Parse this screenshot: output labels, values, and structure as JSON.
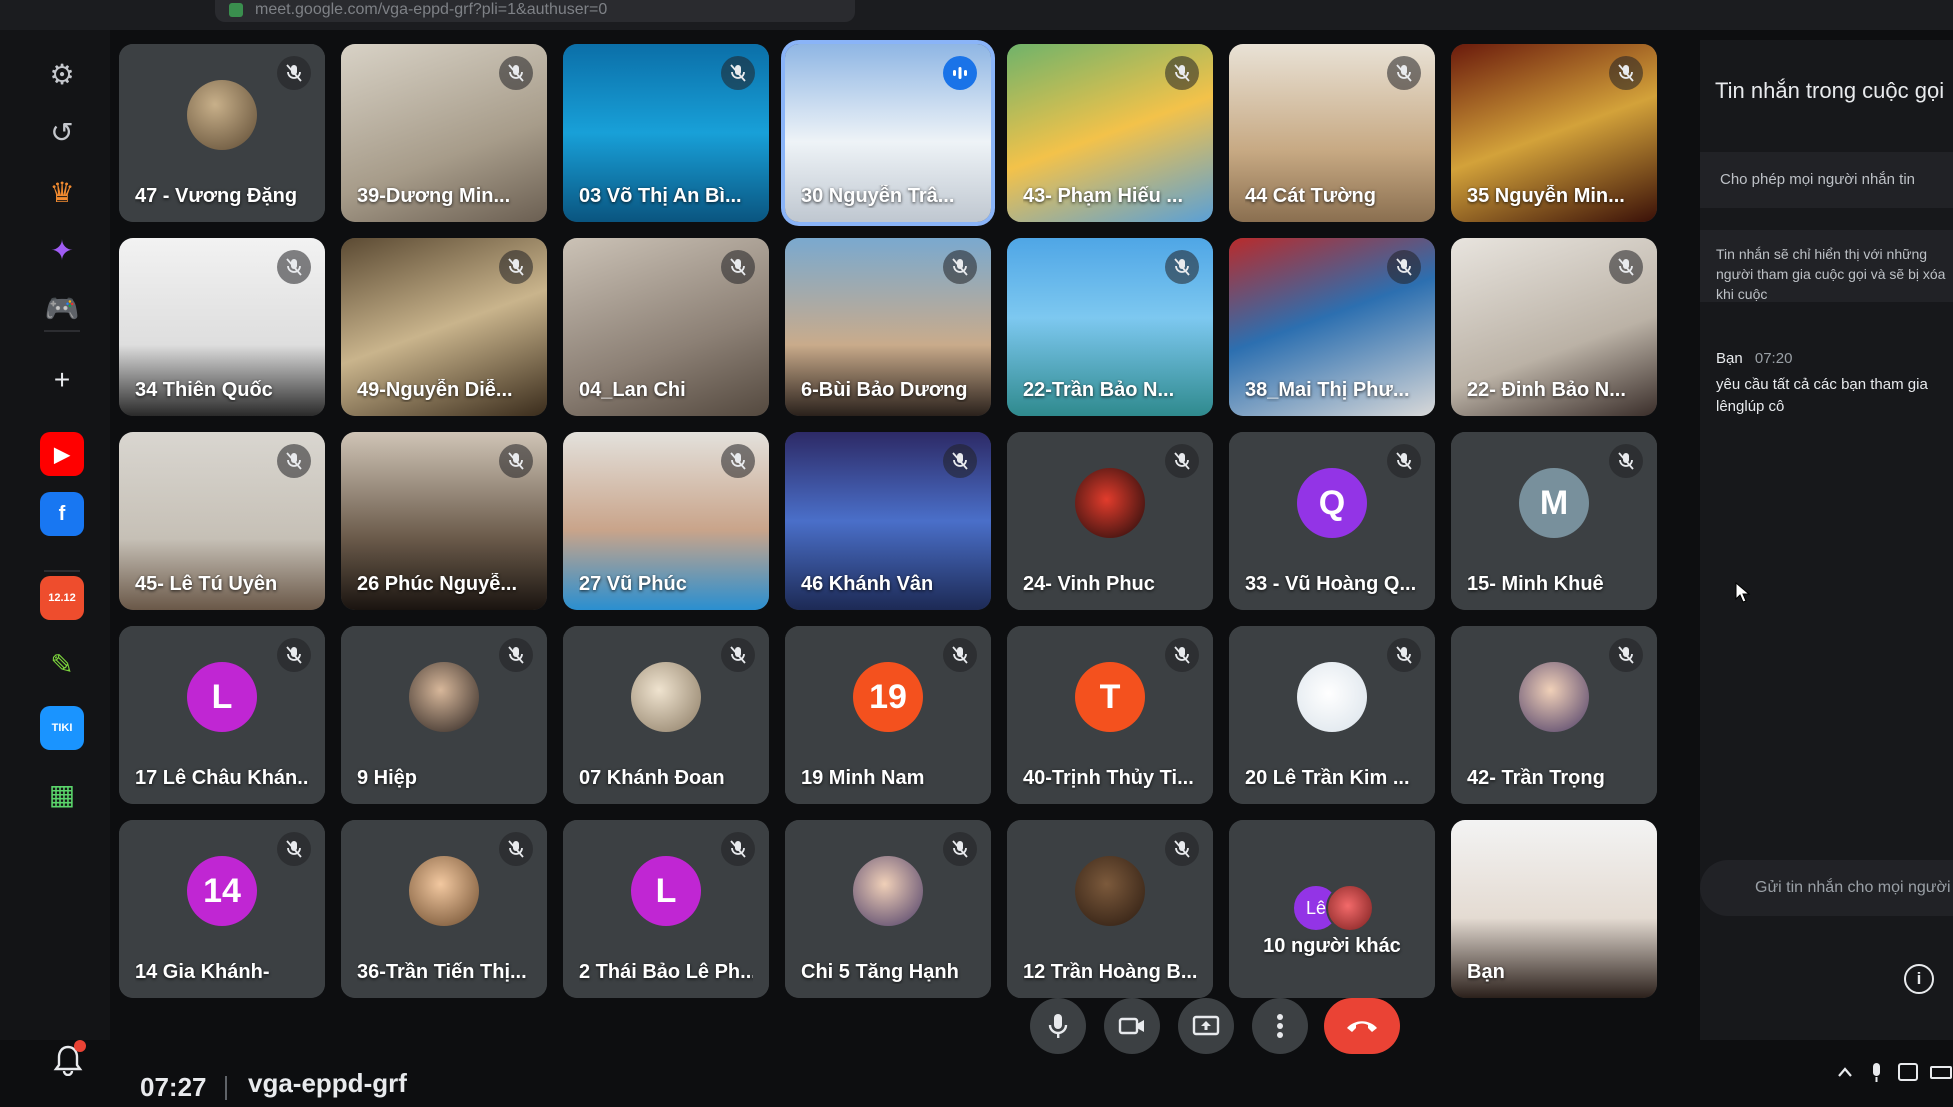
{
  "browser": {
    "url": "meet.google.com/vga-eppd-grf?pli=1&authuser=0"
  },
  "sidebar": {
    "items": [
      {
        "name": "settings-icon",
        "glyph": "⚙",
        "color": "#c4c7cc"
      },
      {
        "name": "history-icon",
        "glyph": "↺",
        "color": "#c4c7cc"
      },
      {
        "name": "crown-icon",
        "glyph": "♛",
        "color": "#f28b30"
      },
      {
        "name": "messenger-icon",
        "glyph": "✦",
        "color": "#a05cf5"
      },
      {
        "name": "gamepad-icon",
        "glyph": "🎮",
        "color": "#34c759"
      },
      {
        "name": "add-icon",
        "glyph": "+",
        "color": "#e8eaed"
      },
      {
        "name": "youtube-icon",
        "glyph": "▶",
        "color": "#ff0000"
      },
      {
        "name": "facebook-icon",
        "glyph": "f",
        "color": "#1877f2"
      },
      {
        "name": "calendar-icon",
        "glyph": "12.12",
        "color": "#ee4d2d"
      },
      {
        "name": "paint-icon",
        "glyph": "✎",
        "color": "#7bd23c"
      },
      {
        "name": "tiki-icon",
        "glyph": "TIKI",
        "color": "#1a94ff"
      },
      {
        "name": "grid-icon",
        "glyph": "▦",
        "color": "#5bd66b"
      }
    ]
  },
  "participants": [
    {
      "name": "47 - Vương Đặng",
      "kind": "avatar",
      "style": "photo-avatar",
      "bg": "#3c4043"
    },
    {
      "name": "39-Dương Min...",
      "kind": "video",
      "bg": "linear-gradient(160deg,#d8d2c6,#a79c8a 60%,#6b5f52)"
    },
    {
      "name": "03 Võ Thị An Bì...",
      "kind": "video",
      "bg": "linear-gradient(180deg,#0b6fa8,#18a0d8 50%,#0a5580)"
    },
    {
      "name": "30 Nguyễn Trâ...",
      "kind": "video",
      "bg": "linear-gradient(180deg,#8fb6e4,#eef3f7 55%,#bfc7d0)",
      "active": true
    },
    {
      "name": "43- Phạm Hiếu ...",
      "kind": "video",
      "bg": "linear-gradient(160deg,#6fb36a,#f3c24a 50%,#5aa0d6)"
    },
    {
      "name": "44 Cát Tường",
      "kind": "video",
      "bg": "linear-gradient(180deg,#e9e2d6,#c7a983 60%,#8a6f50)"
    },
    {
      "name": "35 Nguyễn Min...",
      "kind": "video",
      "bg": "linear-gradient(160deg,#6a1a0c,#d3a23a 50%,#3a1008)"
    },
    {
      "name": "34 Thiên Quốc",
      "kind": "video",
      "bg": "linear-gradient(180deg,#f2f2f2,#dedede 60%,#2a2a2a)"
    },
    {
      "name": "49-Nguyễn Diễ...",
      "kind": "video",
      "bg": "linear-gradient(160deg,#5b4a33,#c9b48c 50%,#3a2c1c)"
    },
    {
      "name": "04_Lan Chi",
      "kind": "video",
      "bg": "linear-gradient(160deg,#cbc2b6,#8c8075 60%,#54493f)"
    },
    {
      "name": "6-Bùi Bảo Dương",
      "kind": "video",
      "bg": "linear-gradient(180deg,#7aa9cf,#c9ab8b 60%,#2a211c)"
    },
    {
      "name": "22-Trần Bảo N...",
      "kind": "video",
      "bg": "linear-gradient(180deg,#4fa6e6,#7dc8f0 45%,#2f8a8e)"
    },
    {
      "name": "38_Mai Thị Phư...",
      "kind": "video",
      "bg": "linear-gradient(160deg,#b92b2b,#2c6fb0 45%,#d8d8d8)"
    },
    {
      "name": "22- Đinh Bảo N...",
      "kind": "video",
      "bg": "linear-gradient(160deg,#e8e4de,#bbb2a6 60%,#3a2e2a)"
    },
    {
      "name": "45- Lê Tú Uyên",
      "kind": "video",
      "bg": "linear-gradient(180deg,#d9d6d0,#c6c0b6 60%,#6a5848)"
    },
    {
      "name": "26 Phúc Nguyễ...",
      "kind": "video",
      "bg": "linear-gradient(180deg,#cfc4b6,#6a5a4a 60%,#1a1410)"
    },
    {
      "name": "27 Vũ Phúc",
      "kind": "video",
      "bg": "linear-gradient(180deg,#e3e1dc,#c9a48a 55%,#2a8fd0)"
    },
    {
      "name": "46 Khánh Vân",
      "kind": "video",
      "bg": "linear-gradient(180deg,#2d2a66,#4a6fc9 50%,#1d2a55)"
    },
    {
      "name": "24- Vinh Phuc",
      "kind": "avatar",
      "style": "photo-avatar red",
      "bg": "#3c4043"
    },
    {
      "name": "33 - Vũ Hoàng Q...",
      "kind": "letter",
      "letter": "Q",
      "color": "#9334e6",
      "bg": "#3c4043"
    },
    {
      "name": "15- Minh Khuê",
      "kind": "letter",
      "letter": "M",
      "color": "#78909c",
      "bg": "#3c4043"
    },
    {
      "name": "17 Lê Châu Khán...",
      "kind": "letter",
      "letter": "L",
      "color": "#c026d3",
      "bg": "#3c4043"
    },
    {
      "name": "9 Hiệp",
      "kind": "avatar",
      "style": "photo-avatar girl",
      "bg": "#3c4043"
    },
    {
      "name": "07 Khánh Đoan",
      "kind": "avatar",
      "style": "photo-avatar cat",
      "bg": "#3c4043"
    },
    {
      "name": "19 Minh Nam",
      "kind": "letter",
      "letter": "19",
      "color": "#f4511e",
      "bg": "#3c4043"
    },
    {
      "name": "40-Trịnh Thủy Ti...",
      "kind": "letter",
      "letter": "T",
      "color": "#f4511e",
      "bg": "#3c4043"
    },
    {
      "name": "20 Lê Trần Kim ...",
      "kind": "avatar",
      "style": "photo-avatar white",
      "bg": "#3c4043"
    },
    {
      "name": "42- Trần Trọng",
      "kind": "avatar",
      "style": "photo-avatar face",
      "bg": "#3c4043"
    },
    {
      "name": "14 Gia Khánh-",
      "kind": "letter",
      "letter": "14",
      "color": "#c026d3",
      "bg": "#3c4043"
    },
    {
      "name": "36-Trần Tiến Thị...",
      "kind": "avatar",
      "style": "photo-avatar kid",
      "bg": "#3c4043"
    },
    {
      "name": "2 Thái Bảo Lê Ph...",
      "kind": "letter",
      "letter": "L",
      "color": "#c026d3",
      "bg": "#3c4043"
    },
    {
      "name": "Chi 5 Tăng Hạnh",
      "kind": "avatar",
      "style": "photo-avatar face",
      "bg": "#3c4043"
    },
    {
      "name": "12 Trần Hoàng B...",
      "kind": "avatar",
      "style": "photo-avatar dark",
      "bg": "#3c4043"
    },
    {
      "name": "10 người khác",
      "kind": "stack",
      "stack_letter": "Lê",
      "bg": "#3c4043",
      "nomute": true
    },
    {
      "name": "Bạn",
      "kind": "video",
      "bg": "linear-gradient(180deg,#f3f3f3,#e4dbd2 55%,#2b201b)",
      "nomute": true
    }
  ],
  "chat": {
    "title": "Tin nhắn trong cuộc gọi",
    "allow_label": "Cho phép mọi người nhắn tin",
    "notice": "Tin nhắn sẽ chỉ hiển thị với những người tham gia cuộc gọi và sẽ bị xóa khi cuộc",
    "message": {
      "sender": "Bạn",
      "time": "07:20",
      "text": "yêu cầu tất cả các bạn tham gia lênglúp cô"
    },
    "send_placeholder": "Gửi tin nhắn cho mọi người",
    "info_label": "i"
  },
  "meeting": {
    "clock": "07:27",
    "code": "vga-eppd-grf"
  },
  "controls": {
    "mic": "mic-icon",
    "camera": "camera-icon",
    "present": "present-icon",
    "more": "more-icon",
    "leave": "leave-call-icon"
  },
  "colors": {
    "leave": "#ea4335",
    "active_border": "#8ab4f8",
    "tile": "#3c4043"
  }
}
